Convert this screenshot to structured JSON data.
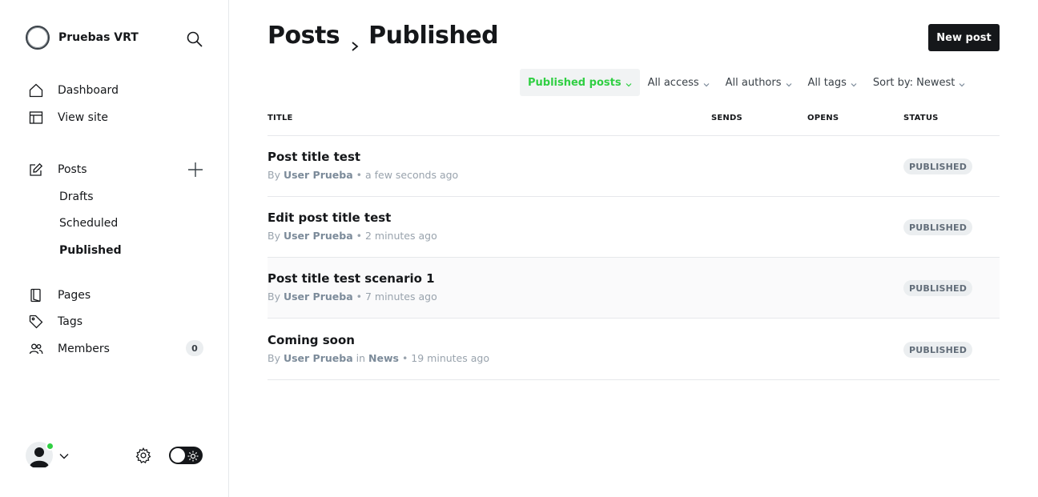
{
  "brand": {
    "name": "Pruebas VRT",
    "logo_icon": "circle-logo-icon"
  },
  "sidebar": {
    "search_icon": "search-icon",
    "nav": [
      {
        "label": "Dashboard",
        "icon": "home-icon"
      },
      {
        "label": "View site",
        "icon": "layout-icon"
      }
    ],
    "posts": {
      "label": "Posts",
      "icon": "edit-icon",
      "add_icon": "plus-icon",
      "children": [
        {
          "label": "Drafts",
          "active": false
        },
        {
          "label": "Scheduled",
          "active": false
        },
        {
          "label": "Published",
          "active": true
        }
      ]
    },
    "nav2": [
      {
        "label": "Pages",
        "icon": "page-icon"
      },
      {
        "label": "Tags",
        "icon": "tag-icon"
      },
      {
        "label": "Members",
        "icon": "members-icon",
        "count": "0"
      }
    ],
    "footer": {
      "avatar_icon": "user-avatar-icon",
      "status_color": "#30cf43",
      "settings_icon": "gear-icon",
      "theme_toggle_icon": "sun-icon"
    }
  },
  "header": {
    "breadcrumb_parent": "Posts",
    "breadcrumb_current": "Published",
    "new_post_label": "New post"
  },
  "filters": [
    {
      "label": "Published posts",
      "active": true
    },
    {
      "label": "All access",
      "active": false
    },
    {
      "label": "All authors",
      "active": false
    },
    {
      "label": "All tags",
      "active": false
    },
    {
      "label": "Sort by: Newest",
      "active": false
    }
  ],
  "table": {
    "columns": [
      "TITLE",
      "SENDS",
      "OPENS",
      "STATUS"
    ],
    "rows": [
      {
        "title": "Post title test",
        "by": "By",
        "author": "User Prueba",
        "in": "",
        "tag": "",
        "time": "• a few seconds ago",
        "status": "PUBLISHED"
      },
      {
        "title": "Edit post title test",
        "by": "By",
        "author": "User Prueba",
        "in": "",
        "tag": "",
        "time": "• 2 minutes ago",
        "status": "PUBLISHED"
      },
      {
        "title": "Post title test scenario 1",
        "by": "By",
        "author": "User Prueba",
        "in": "",
        "tag": "",
        "time": "• 7 minutes ago",
        "status": "PUBLISHED"
      },
      {
        "title": "Coming soon",
        "by": "By",
        "author": "User Prueba",
        "in": "in",
        "tag": "News",
        "time": "• 19 minutes ago",
        "status": "PUBLISHED"
      }
    ]
  },
  "colors": {
    "accent_green": "#30cf43",
    "primary_dark": "#15171a",
    "muted_text": "#99a3ad"
  }
}
